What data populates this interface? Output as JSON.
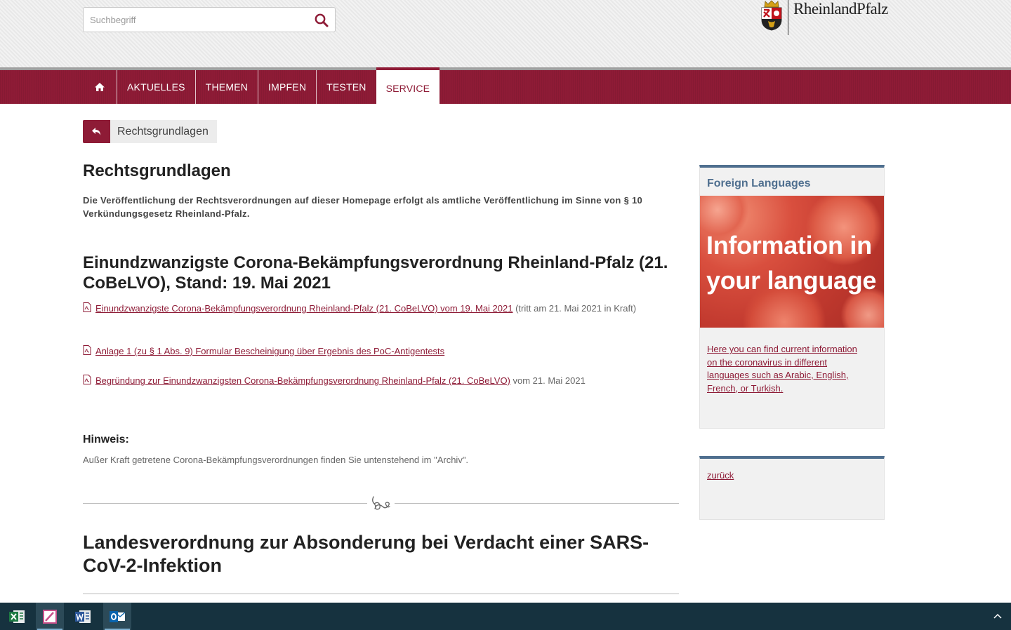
{
  "header": {
    "search_placeholder": "Suchbegriff",
    "logo_text": "RheinlandPfalz"
  },
  "nav": {
    "items": [
      {
        "label": "AKTUELLES"
      },
      {
        "label": "THEMEN"
      },
      {
        "label": "IMPFEN"
      },
      {
        "label": "TESTEN"
      },
      {
        "label": "SERVICE",
        "active": true
      }
    ]
  },
  "breadcrumb": {
    "label": "Rechtsgrundlagen"
  },
  "main": {
    "title": "Rechtsgrundlagen",
    "intro": "Die Veröffentlichung der Rechtsverordnungen auf dieser Homepage erfolgt als amtliche Veröffentlichung im Sinne von § 10 Verkündungsgesetz Rheinland-Pfalz.",
    "section1_title": "Einundzwanzigste Corona-Bekämpfungsverordnung Rheinland-Pfalz (21. CoBeLVO), Stand: 19. Mai 2021",
    "docs": [
      {
        "link": "Einundzwanzigste Corona-Bekämpfungsverordnung Rheinland-Pfalz (21. CoBeLVO) vom 19. Mai 2021",
        "suffix": " (tritt am 21. Mai 2021 in Kraft)"
      },
      {
        "link": "Anlage 1 (zu § 1 Abs. 9) Formular Bescheinigung über Ergebnis des PoC-Antigentests ",
        "suffix": ""
      },
      {
        "link": "Begründung zur Einundzwanzigsten Corona-Bekämpfungsverordnung Rheinland-Pfalz (21. CoBeLVO)",
        "suffix": " vom 21. Mai 2021"
      }
    ],
    "hinweis_title": "Hinweis:",
    "hinweis_text": "Außer Kraft getretene Corona-Bekämpfungsverordnungen finden Sie untenstehend im \"Archiv\".",
    "section2_title": "Landesverordnung zur Absonderung bei Verdacht einer SARS-CoV-2-Infektion"
  },
  "sidebar": {
    "box1_title": "Foreign Languages",
    "image_text": "Information in your language",
    "box1_link": "Here you can find current information on the coronavirus in different languages such as Arabic, English, French, or Turkish.",
    "box2_link": "zurück"
  },
  "colors": {
    "brand": "#8e1b36",
    "sidebar_accent": "#4f6f8f",
    "taskbar": "#16323f"
  },
  "taskbar": {
    "apps": [
      "excel-icon",
      "paint-icon",
      "word-icon",
      "outlook-icon"
    ]
  }
}
